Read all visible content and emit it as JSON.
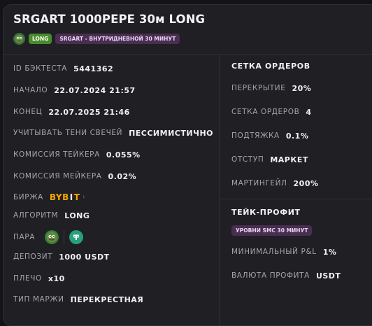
{
  "header": {
    "title": "SRGART 1000PEPE 30м LONG",
    "badge_long": "LONG",
    "badge_strategy": "SRGART - ВНУТРИДНЕВНОЙ 30 МИНУТ"
  },
  "left": {
    "backtest_id_label": "ID БЭКТЕСТА",
    "backtest_id": "5441362",
    "start_label": "НАЧАЛО",
    "start": "22.07.2024 21:57",
    "end_label": "КОНЕЦ",
    "end": "22.07.2025 21:46",
    "shadows_label": "УЧИТЫВАТЬ ТЕНИ СВЕЧЕЙ",
    "shadows": "ПЕССИМИСТИЧНО",
    "taker_label": "КОМИССИЯ ТЕЙКЕРА",
    "taker": "0.055%",
    "maker_label": "КОМИССИЯ МЕЙКЕРА",
    "maker": "0.02%",
    "exchange_label": "БИРЖА",
    "exchange_a": "BYB",
    "exchange_sep": "I",
    "exchange_b": "T",
    "algo_label": "АЛГОРИТМ",
    "algo": "LONG",
    "pair_label": "ПАРА",
    "deposit_label": "ДЕПОЗИТ",
    "deposit": "1000 USDT",
    "leverage_label": "ПЛЕЧО",
    "leverage": "x10",
    "margin_label": "ТИП МАРЖИ",
    "margin": "ПЕРЕКРЕСТНАЯ"
  },
  "grid": {
    "title": "СЕТКА ОРДЕРОВ",
    "overlap_label": "ПЕРЕКРЫТИЕ",
    "overlap": "20%",
    "orders_label": "СЕТКА ОРДЕРОВ",
    "orders": "4",
    "pullup_label": "ПОДТЯЖКА",
    "pullup": "0.1%",
    "indent_label": "ОТСТУП",
    "indent": "МАРКЕТ",
    "martingale_label": "МАРТИНГЕЙЛ",
    "martingale": "200%"
  },
  "takeprofit": {
    "title": "ТЕЙК-ПРОФИТ",
    "badge": "УРОВНИ SMC 30 МИНУТ",
    "min_pnl_label": "МИНИМАЛЬНЫЙ P&L",
    "min_pnl": "1%",
    "currency_label": "ВАЛЮТА ПРОФИТА",
    "currency": "USDT"
  },
  "colors": {
    "long_badge": "#4a8a2d",
    "strategy_badge": "#4a2d52",
    "bybit": "#f7a600",
    "tether": "#26a17b"
  }
}
